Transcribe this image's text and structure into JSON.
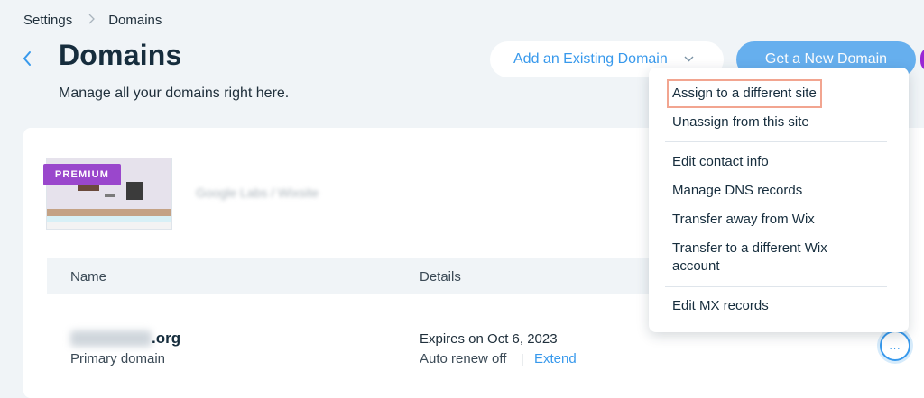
{
  "breadcrumb": {
    "root": "Settings",
    "current": "Domains"
  },
  "header": {
    "title": "Domains",
    "subtitle": "Manage all your domains right here.",
    "add_existing_label": "Add an Existing Domain",
    "get_new_label": "Get a New Domain"
  },
  "site": {
    "badge": "PREMIUM",
    "name": "Google Labs / Wixsite"
  },
  "table": {
    "columns": [
      "Name",
      "Details"
    ],
    "rows": [
      {
        "domain_tld": ".org",
        "domain_type": "Primary domain",
        "expires": "Expires on Oct 6, 2023",
        "auto_renew": "Auto renew off",
        "separator": "|",
        "extend_label": "Extend",
        "more_label": "..."
      }
    ]
  },
  "menu": {
    "items": [
      "Assign to a different site",
      "Unassign from this site",
      "Edit contact info",
      "Manage DNS records",
      "Transfer away from Wix",
      "Transfer to a different Wix account",
      "Edit MX records"
    ]
  },
  "icons": {
    "back": "chevron-left-icon",
    "dropdown": "chevron-down-icon",
    "breadcrumb_sep": "chevron-right-icon",
    "more": "ellipsis-icon"
  },
  "colors": {
    "accent": "#3899ec",
    "premium": "#9a47cc",
    "highlight": "#f2a590"
  }
}
